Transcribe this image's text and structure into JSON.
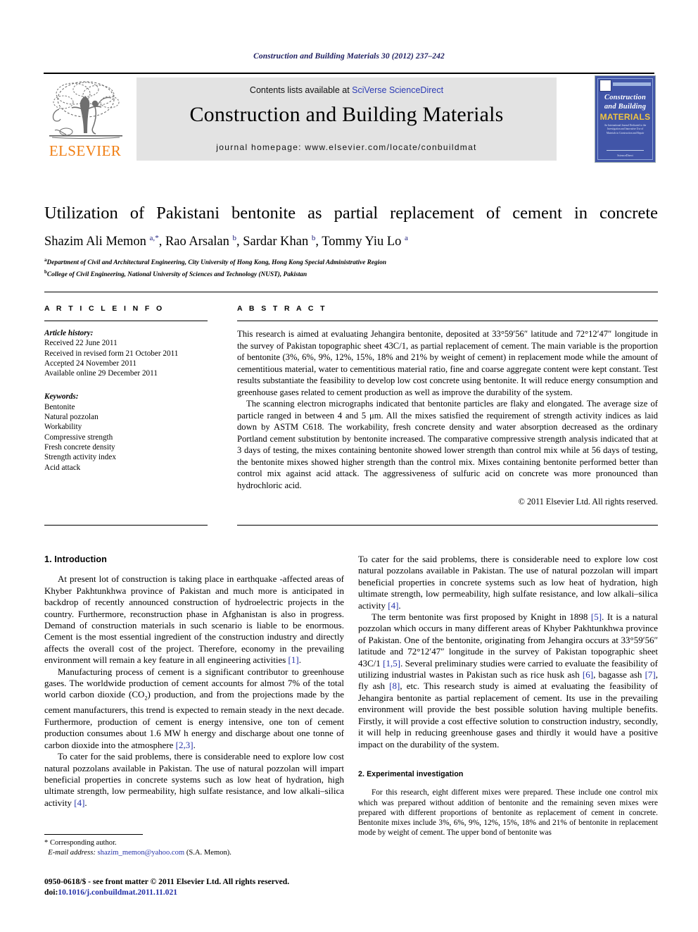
{
  "running_head": "Construction and Building Materials 30 (2012) 237–242",
  "masthead": {
    "publisher_name": "ELSEVIER",
    "contents_prefix": "Contents lists available at ",
    "contents_link": "SciVerse ScienceDirect",
    "journal_title": "Construction and Building Materials",
    "homepage": "journal homepage: www.elsevier.com/locate/conbuildmat",
    "cover": {
      "line1": "Construction",
      "line2": "and Building",
      "line3": "MATERIALS",
      "blurb": "An International Journal Dedicated to the Investigation and Innovative Use of Materials in Construction and Repair",
      "foot": "ScienceDirect"
    },
    "link_color": "#2c3bb5",
    "banner_bg": "#e3e3e3",
    "elsevier_orange": "#F07E13"
  },
  "article": {
    "title": "Utilization of Pakistani bentonite as partial replacement of cement in concrete",
    "authors_html": "Shazim Ali Memon <sup>a,</sup><sup>*</sup>, Rao Arsalan <sup>b</sup>, Sardar Khan <sup>b</sup>, Tommy Yiu Lo <sup>a</sup>",
    "affiliations": [
      {
        "marker": "a",
        "text": "Department of Civil and Architectural Engineering, City University of Hong Kong, Hong Kong Special Administrative Region"
      },
      {
        "marker": "b",
        "text": "College of Civil Engineering, National University of Sciences and Technology (NUST), Pakistan"
      }
    ]
  },
  "article_info": {
    "heading": "A R T I C L E    I N F O",
    "history_label": "Article history:",
    "history": [
      "Received 22 June 2011",
      "Received in revised form 21 October 2011",
      "Accepted 24 November 2011",
      "Available online 29 December 2011"
    ],
    "keywords_label": "Keywords:",
    "keywords": [
      "Bentonite",
      "Natural pozzolan",
      "Workability",
      "Compressive strength",
      "Fresh concrete density",
      "Strength activity index",
      "Acid attack"
    ]
  },
  "abstract": {
    "heading": "A B S T R A C T",
    "paragraphs": [
      "This research is aimed at evaluating Jehangira bentonite, deposited at 33°59′56″ latitude and 72°12′47″ longitude in the survey of Pakistan topographic sheet 43C/1, as partial replacement of cement. The main variable is the proportion of bentonite (3%, 6%, 9%, 12%, 15%, 18% and 21% by weight of cement) in replacement mode while the amount of cementitious material, water to cementitious material ratio, fine and coarse aggregate content were kept constant. Test results substantiate the feasibility to develop low cost concrete using bentonite. It will reduce energy consumption and greenhouse gases related to cement production as well as improve the durability of the system.",
      "The scanning electron micrographs indicated that bentonite particles are flaky and elongated. The average size of particle ranged in between 4 and 5 μm. All the mixes satisfied the requirement of strength activity indices as laid down by ASTM C618. The workability, fresh concrete density and water absorption decreased as the ordinary Portland cement substitution by bentonite increased. The comparative compressive strength analysis indicated that at 3 days of testing, the mixes containing bentonite showed lower strength than control mix while at 56 days of testing, the bentonite mixes showed higher strength than the control mix. Mixes containing bentonite performed better than control mix against acid attack. The aggressiveness of sulfuric acid on concrete was more pronounced than hydrochloric acid."
    ],
    "copyright": "© 2011 Elsevier Ltd. All rights reserved."
  },
  "sections": {
    "intro_heading": "1. Introduction",
    "intro_paragraphs": [
      "At present lot of construction is taking place in earthquake -affected areas of Khyber Pakhtunkhwa province of Pakistan and much more is anticipated in backdrop of recently announced construction of hydroelectric projects in the country. Furthermore, reconstruction phase in Afghanistan is also in progress. Demand of construction materials in such scenario is liable to be enormous. Cement is the most essential ingredient of the construction industry and directly affects the overall cost of the project. Therefore, economy in the prevailing environment will remain a key feature in all engineering activities [1].",
      "Manufacturing process of cement is a significant contributor to greenhouse gases. The worldwide production of cement accounts for almost 7% of the total world carbon dioxide (CO2) production, and from the projections made by the cement manufacturers, this trend is expected to remain steady in the next decade. Furthermore, production of cement is energy intensive, one ton of cement production consumes about 1.6 MW h energy and discharge about one tonne of carbon dioxide into the atmosphere [2,3].",
      "To cater for the said problems, there is considerable need to explore low cost natural pozzolans available in Pakistan. The use of natural pozzolan will impart beneficial properties in concrete systems such as low heat of hydration, high ultimate strength, low permeability, high sulfate resistance, and low alkali–silica activity [4].",
      "The term bentonite was first proposed by Knight in 1898 [5]. It is a natural pozzolan which occurs in many different areas of Khyber Pakhtunkhwa province of Pakistan. One of the bentonite, originating from Jehangira occurs at 33°59′56″ latitude and 72°12′47″ longitude in the survey of Pakistan topographic sheet 43C/1 [1,5]. Several preliminary studies were carried to evaluate the feasibility of utilizing industrial wastes in Pakistan such as rice husk ash [6], bagasse ash [7], fly ash [8], etc. This research study is aimed at evaluating the feasibility of Jehangira bentonite as partial replacement of cement. Its use in the prevailing environment will provide the best possible solution having multiple benefits. Firstly, it will provide a cost effective solution to construction industry, secondly, it will help in reducing greenhouse gases and thirdly it would have a positive impact on the durability of the system."
    ],
    "exp_heading": "2. Experimental investigation",
    "exp_paragraph": "For this research, eight different mixes were prepared. These include one control mix which was prepared without addition of bentonite and the remaining seven mixes were prepared with different proportions of bentonite as replacement of cement in concrete. Bentonite mixes include 3%, 6%, 9%, 12%, 15%, 18% and 21% of bentonite in replacement mode by weight of cement. The upper bond of bentonite was"
  },
  "footnote": {
    "corresponding": "* Corresponding author.",
    "email_label": "E-mail address:",
    "email": "shazim_memon@yahoo.com",
    "email_suffix": "(S.A. Memon)."
  },
  "footer": {
    "line1": "0950-0618/$ - see front matter © 2011 Elsevier Ltd. All rights reserved.",
    "doi_label": "doi:",
    "doi": "10.1016/j.conbuildmat.2011.11.021"
  }
}
